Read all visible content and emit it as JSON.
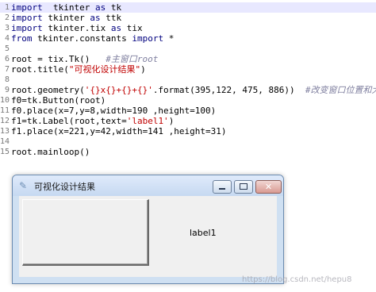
{
  "editor": {
    "lines": [
      {
        "n": "1",
        "t": [
          [
            "kw",
            "import"
          ],
          [
            "",
            "  tkinter "
          ],
          [
            "kw",
            "as"
          ],
          [
            "",
            " tk"
          ]
        ]
      },
      {
        "n": "2",
        "t": [
          [
            "kw",
            "import"
          ],
          [
            "",
            " tkinter "
          ],
          [
            "kw",
            "as"
          ],
          [
            "",
            " ttk"
          ]
        ]
      },
      {
        "n": "3",
        "t": [
          [
            "kw",
            "import"
          ],
          [
            "",
            " tkinter.tix "
          ],
          [
            "kw",
            "as"
          ],
          [
            "",
            " tix"
          ]
        ]
      },
      {
        "n": "4",
        "t": [
          [
            "kw",
            "from"
          ],
          [
            "",
            " tkinter.constants "
          ],
          [
            "kw",
            "import"
          ],
          [
            "",
            " *"
          ]
        ]
      },
      {
        "n": "5",
        "t": []
      },
      {
        "n": "6",
        "t": [
          [
            "",
            "root = tix.Tk()   "
          ],
          [
            "cm",
            "#主窗口root"
          ]
        ]
      },
      {
        "n": "7",
        "t": [
          [
            "",
            "root.title("
          ],
          [
            "str",
            "\"可视化设计结果\""
          ],
          [
            "",
            ")"
          ]
        ]
      },
      {
        "n": "8",
        "t": []
      },
      {
        "n": "9",
        "t": [
          [
            "",
            "root.geometry("
          ],
          [
            "str",
            "'{}x{}+{}+{}'"
          ],
          [
            "",
            ".format(395,122, 475, 886))  "
          ],
          [
            "cm",
            "#改变窗口位置和大小"
          ]
        ]
      },
      {
        "n": "10",
        "t": [
          [
            "",
            "f0=tk.Button(root)"
          ]
        ]
      },
      {
        "n": "11",
        "t": [
          [
            "",
            "f0.place(x=7,y=8,width=190 ,height=100)"
          ]
        ]
      },
      {
        "n": "12",
        "t": [
          [
            "",
            "f1=tk.Label(root,text="
          ],
          [
            "str",
            "'label1'"
          ],
          [
            "",
            ")"
          ]
        ]
      },
      {
        "n": "13",
        "t": [
          [
            "",
            "f1.place(x=221,y=42,width=141 ,height=31)"
          ]
        ]
      },
      {
        "n": "14",
        "t": []
      },
      {
        "n": "15",
        "t": [
          [
            "",
            "root.mainloop()"
          ]
        ]
      }
    ]
  },
  "window": {
    "title": "可视化设计结果",
    "title_icon": "feather-icon",
    "minimize_icon": "minimize-icon",
    "maximize_icon": "maximize-icon",
    "close_glyph": "✕",
    "label_text": "label1"
  },
  "watermark": "https://blog.csdn.net/hepu8",
  "colors": {
    "keyword": "#00007f",
    "string": "#c00000",
    "comment": "#7f7f9f",
    "current_line": "#e8e8ff",
    "window_frame": "#cfe0f2"
  }
}
